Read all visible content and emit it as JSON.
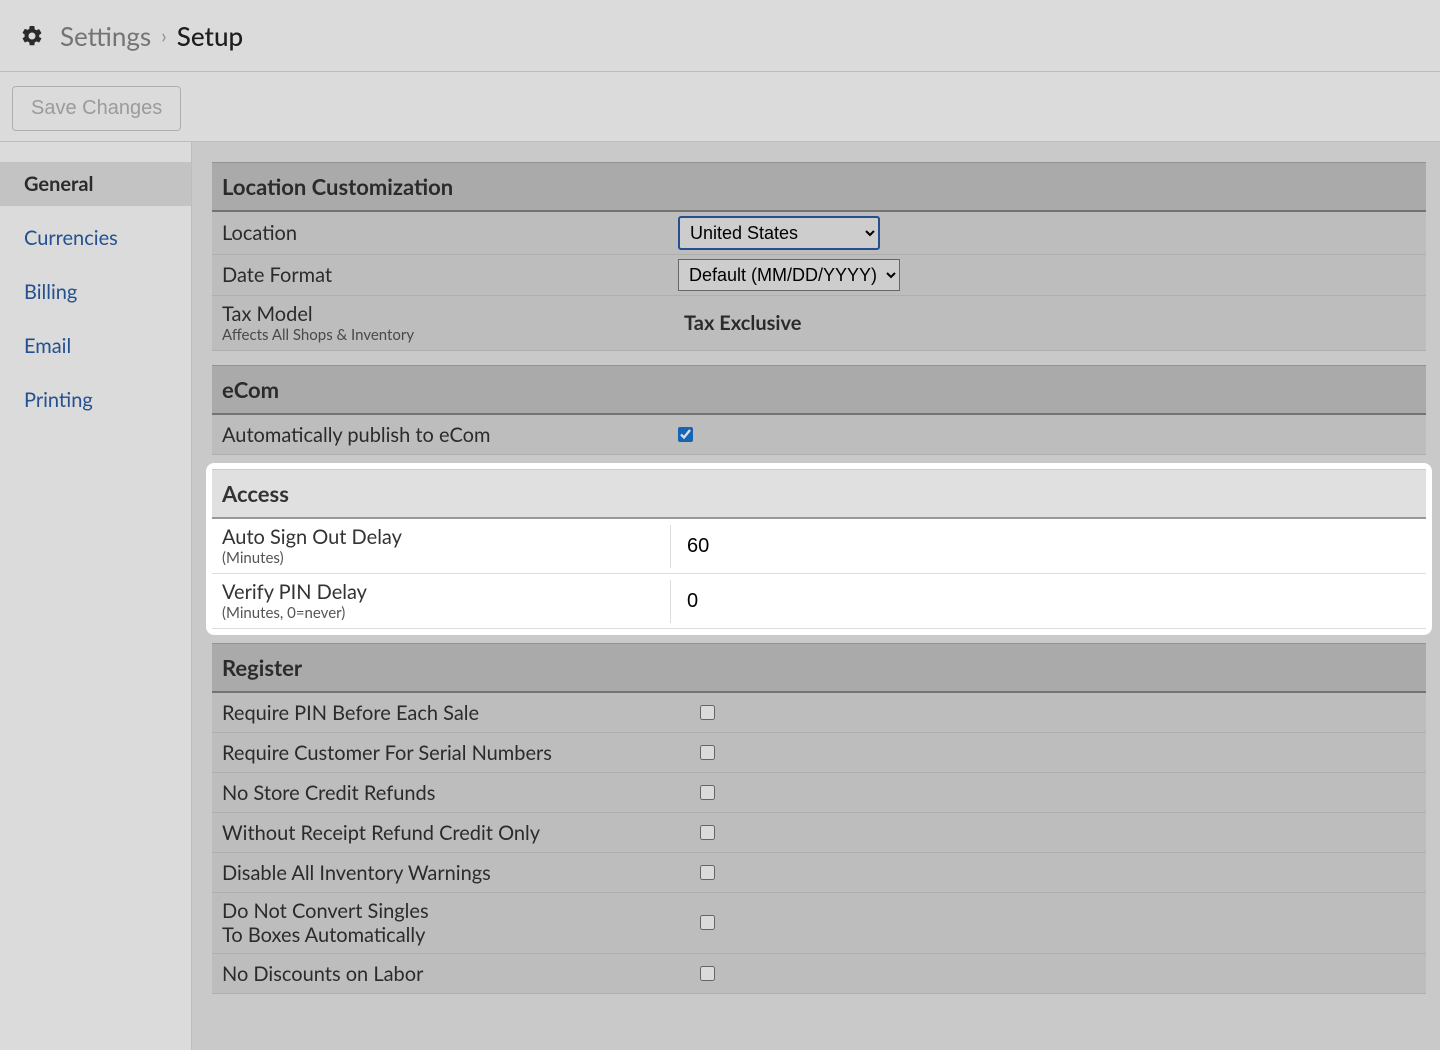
{
  "header": {
    "breadcrumb_parent": "Settings",
    "breadcrumb_current": "Setup"
  },
  "toolbar": {
    "save_label": "Save Changes"
  },
  "sidebar": {
    "items": [
      {
        "label": "General",
        "active": true
      },
      {
        "label": "Currencies",
        "active": false
      },
      {
        "label": "Billing",
        "active": false
      },
      {
        "label": "Email",
        "active": false
      },
      {
        "label": "Printing",
        "active": false
      }
    ]
  },
  "sections": {
    "location": {
      "title": "Location Customization",
      "location_label": "Location",
      "location_value": "United States",
      "date_format_label": "Date Format",
      "date_format_value": "Default (MM/DD/YYYY)",
      "tax_model_label": "Tax Model",
      "tax_model_sub": "Affects All Shops & Inventory",
      "tax_model_value": "Tax Exclusive"
    },
    "ecom": {
      "title": "eCom",
      "auto_publish_label": "Automatically publish to eCom",
      "auto_publish_checked": true
    },
    "access": {
      "title": "Access",
      "auto_signout_label": "Auto Sign Out Delay",
      "auto_signout_sub": "(Minutes)",
      "auto_signout_value": "60",
      "verify_pin_label": "Verify PIN Delay",
      "verify_pin_sub": "(Minutes, 0=never)",
      "verify_pin_value": "0"
    },
    "register": {
      "title": "Register",
      "rows": [
        {
          "label": "Require PIN Before Each Sale",
          "checked": false
        },
        {
          "label": "Require Customer For Serial Numbers",
          "checked": false
        },
        {
          "label": "No Store Credit Refunds",
          "checked": false
        },
        {
          "label": "Without Receipt Refund Credit Only",
          "checked": false
        },
        {
          "label": "Disable All Inventory Warnings",
          "checked": false
        },
        {
          "label": "Do Not Convert Singles\nTo Boxes Automatically",
          "checked": false
        },
        {
          "label": "No Discounts on Labor",
          "checked": false
        }
      ]
    }
  }
}
